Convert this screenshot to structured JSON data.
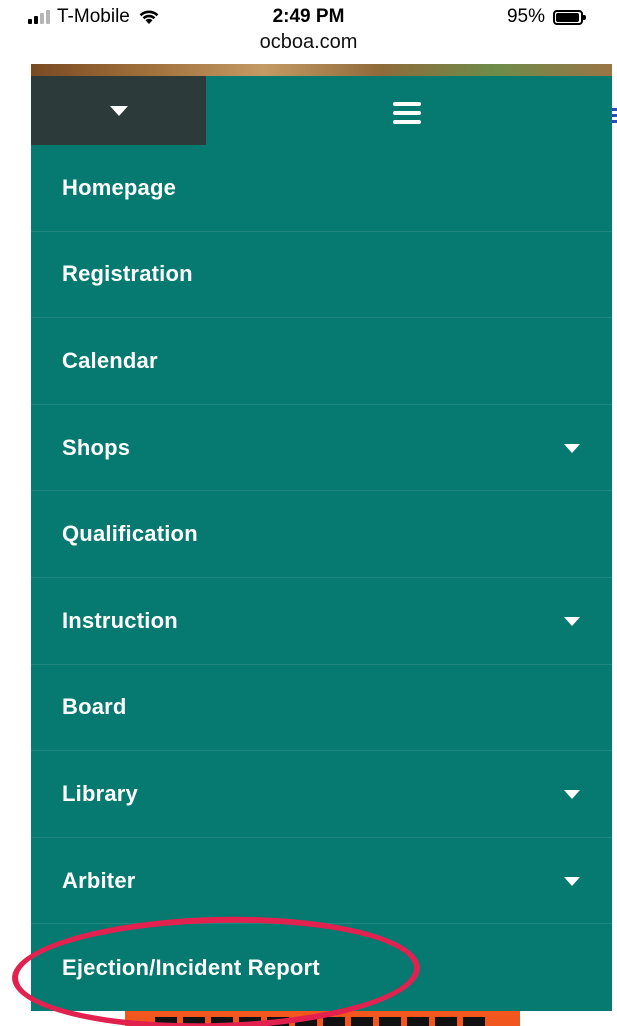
{
  "status_bar": {
    "carrier": "T-Mobile",
    "time": "2:49 PM",
    "battery": "95%"
  },
  "browser": {
    "url": "ocboa.com"
  },
  "nav": {
    "items": [
      {
        "label": "Homepage",
        "has_submenu": false
      },
      {
        "label": "Registration",
        "has_submenu": false
      },
      {
        "label": "Calendar",
        "has_submenu": false
      },
      {
        "label": "Shops",
        "has_submenu": true
      },
      {
        "label": "Qualification",
        "has_submenu": false
      },
      {
        "label": "Instruction",
        "has_submenu": true
      },
      {
        "label": "Board",
        "has_submenu": false
      },
      {
        "label": "Library",
        "has_submenu": true
      },
      {
        "label": "Arbiter",
        "has_submenu": true
      },
      {
        "label": "Ejection/Incident Report",
        "has_submenu": false
      }
    ]
  },
  "colors": {
    "menu_background": "#067a70",
    "toggle_background": "#2d3a3a",
    "annotation": "#e2214f",
    "banner": "#f0561e"
  },
  "icons": {
    "toggle": "caret-down-icon",
    "menu": "hamburger-icon",
    "submenu": "caret-down-icon"
  }
}
